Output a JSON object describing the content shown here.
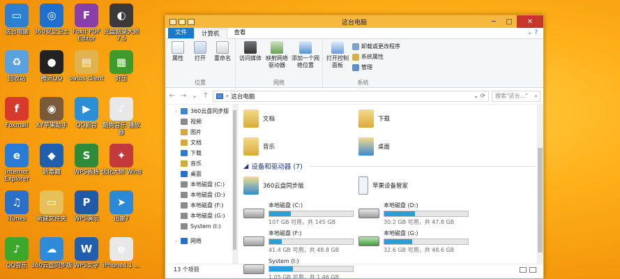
{
  "desktop_icons": [
    {
      "label": "这台电脑",
      "color": "#2f7fd1",
      "glyph": "▭"
    },
    {
      "label": "360安全卫士",
      "color": "#1f6fcf",
      "glyph": "◎"
    },
    {
      "label": "Foxit PDF Editor",
      "color": "#8a3fa8",
      "glyph": "F"
    },
    {
      "label": "光盘刻录大师 7.5",
      "color": "#3a3a3a",
      "glyph": "◐"
    },
    {
      "label": "回收站",
      "color": "#5aa1df",
      "glyph": "♻"
    },
    {
      "label": "腾讯QQ",
      "color": "#222222",
      "glyph": "●"
    },
    {
      "label": "oatos client",
      "color": "#e0b34c",
      "glyph": "▤"
    },
    {
      "label": "好压",
      "color": "#3f9a2c",
      "glyph": "▦"
    },
    {
      "label": "Foxmail",
      "color": "#d73a2c",
      "glyph": "f"
    },
    {
      "label": "XY苹果助手",
      "color": "#7a5a3a",
      "glyph": "◉"
    },
    {
      "label": "QQ影音",
      "color": "#2a8fd6",
      "glyph": "▶"
    },
    {
      "label": "酷狗音乐 播放器",
      "color": "#e8e8e8",
      "glyph": "♪"
    },
    {
      "label": "Internet Explorer",
      "color": "#2a7bd6",
      "glyph": "e"
    },
    {
      "label": "新毒霸",
      "color": "#1f5fae",
      "glyph": "◆"
    },
    {
      "label": "WPS表格",
      "color": "#2e8b3a",
      "glyph": "S"
    },
    {
      "label": "优化大师 Win8",
      "color": "#c23a3a",
      "glyph": "✦"
    },
    {
      "label": "iTunes",
      "color": "#2a6fc8",
      "glyph": "♫"
    },
    {
      "label": "新建文件夹",
      "color": "#e6c15a",
      "glyph": "▭"
    },
    {
      "label": "WPS演示",
      "color": "#1e5aa8",
      "glyph": "P"
    },
    {
      "label": "迅雷7",
      "color": "#2a8ad8",
      "glyph": "➤"
    },
    {
      "label": "QQ音乐",
      "color": "#3aa82a",
      "glyph": "♪"
    },
    {
      "label": "360云盘同步版",
      "color": "#2f8ad8",
      "glyph": "☁"
    },
    {
      "label": "WPS文字",
      "color": "#1f5fae",
      "glyph": "W"
    },
    {
      "label": "iPhone4.1 ...",
      "color": "#e8e8e8",
      "glyph": "e"
    }
  ],
  "window": {
    "title": "这台电脑",
    "tabs": [
      "文件",
      "计算机",
      "查看"
    ],
    "ribbon": {
      "groups": [
        {
          "label": "位置",
          "buttons": [
            "属性",
            "打开",
            "重命名"
          ]
        },
        {
          "label": "网络",
          "buttons": [
            "访问媒体",
            "映射网络驱动器",
            "添加一个网络位置"
          ]
        },
        {
          "label": "系统",
          "big": "打开控制面板",
          "small": [
            "卸载或更改程序",
            "系统属性",
            "管理"
          ]
        }
      ]
    },
    "address": {
      "path": "这台电脑",
      "search_placeholder": "搜索\"这台...\""
    },
    "nav": [
      {
        "label": "360云盘同步版",
        "color": "#2f8ad8"
      },
      {
        "label": "视频",
        "color": "#8a8a8a"
      },
      {
        "label": "图片",
        "color": "#d4a93a"
      },
      {
        "label": "文档",
        "color": "#d4a93a"
      },
      {
        "label": "下载",
        "color": "#2a7bd6"
      },
      {
        "label": "音乐",
        "color": "#d4a93a"
      },
      {
        "label": "桌面",
        "color": "#2a6fc8"
      },
      {
        "label": "本地磁盘 (C:)",
        "color": "#8a8a8a"
      },
      {
        "label": "本地磁盘 (D:)",
        "color": "#8a8a8a"
      },
      {
        "label": "本地磁盘 (F:)",
        "color": "#8a8a8a"
      },
      {
        "label": "本地磁盘 (G:)",
        "color": "#8a8a8a"
      },
      {
        "label": "System (I:)",
        "color": "#8a8a8a"
      },
      {
        "label": "网络",
        "color": "#2a6fc8"
      }
    ],
    "folders": [
      {
        "label": "文档",
        "color": "#e5c463"
      },
      {
        "label": "下载",
        "color": "#3b8ad6"
      },
      {
        "label": "音乐",
        "color": "#e5c463"
      },
      {
        "label": "桌面",
        "color": "#3b8ad6"
      }
    ],
    "devices_header": "设备和驱动器 (7)",
    "devices": [
      {
        "label": "360云盘同步版",
        "color": "#2f8ad8"
      },
      {
        "label": "苹果设备管家",
        "color": "#e8eef5"
      }
    ],
    "drives": [
      {
        "label": "本地磁盘 (C:)",
        "free": "107 GB 可用，共 145 GB",
        "used_pct": 26
      },
      {
        "label": "本地磁盘 (D:)",
        "free": "30.2 GB 可用，共 47.8 GB",
        "used_pct": 37
      },
      {
        "label": "本地磁盘 (F:)",
        "free": "41.4 GB 可用，共 48.8 GB",
        "used_pct": 15
      },
      {
        "label": "本地磁盘 (G:)",
        "free": "32.6 GB 可用，共 48.6 GB",
        "used_pct": 33
      },
      {
        "label": "System (I:)",
        "free": "1.05 GB 可用，共 1.46 GB",
        "used_pct": 28
      }
    ],
    "status": "13 个项目"
  }
}
